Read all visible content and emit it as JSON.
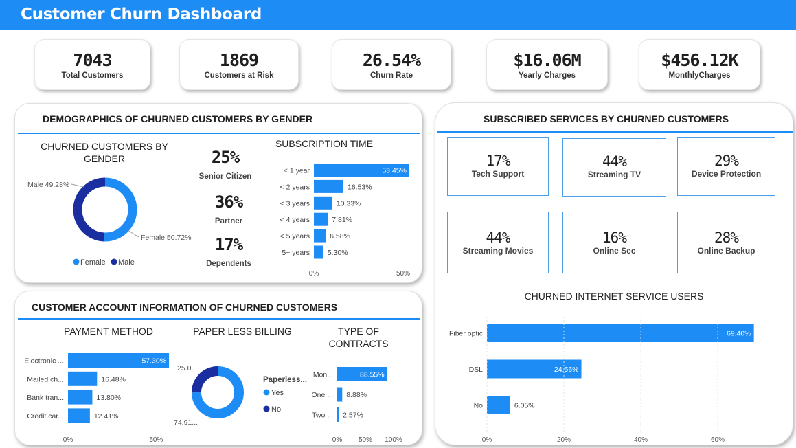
{
  "header": {
    "title": "Customer Churn Dashboard"
  },
  "kpis": [
    {
      "value": "7043",
      "label": "Total Customers"
    },
    {
      "value": "1869",
      "label": "Customers at Risk"
    },
    {
      "value": "26.54%",
      "label": "Churn Rate"
    },
    {
      "value": "$16.06M",
      "label": "Yearly Charges"
    },
    {
      "value": "$456.12K",
      "label": "MonthlyCharges"
    }
  ],
  "demographics": {
    "title": "DEMOGRAPHICS OF CHURNED CUSTOMERS BY GENDER",
    "gender_title": "CHURNED CUSTOMERS BY GENDER",
    "stats": [
      {
        "value": "25%",
        "label": "Senior Citizen"
      },
      {
        "value": "36%",
        "label": "Partner"
      },
      {
        "value": "17%",
        "label": "Dependents"
      }
    ],
    "subscription_title": "SUBSCRIPTION TIME"
  },
  "account": {
    "title": "CUSTOMER ACCOUNT INFORMATION OF CHURNED CUSTOMERS",
    "payment_title": "PAYMENT METHOD",
    "paperless_title": "PAPER LESS BILLING",
    "contracts_title": "TYPE OF CONTRACTS"
  },
  "services": {
    "title": "SUBSCRIBED SERVICES BY CHURNED CUSTOMERS",
    "cards": [
      {
        "value": "17%",
        "label": "Tech Support"
      },
      {
        "value": "44%",
        "label": "Streaming TV"
      },
      {
        "value": "29%",
        "label": "Device Protection"
      },
      {
        "value": "44%",
        "label": "Streaming Movies"
      },
      {
        "value": "16%",
        "label": "Online Sec"
      },
      {
        "value": "28%",
        "label": "Online Backup"
      }
    ],
    "internet_title": "CHURNED INTERNET SERVICE USERS"
  },
  "colors": {
    "accent": "#1e8cf5",
    "dark": "#1a2ea0"
  },
  "chart_data": [
    {
      "type": "pie",
      "subtype": "donut",
      "categories": [
        "Female",
        "Male"
      ],
      "values": [
        50.72,
        49.28
      ],
      "labels": [
        "Female 50.72%",
        "Male 49.28%"
      ],
      "legend": [
        "Female",
        "Male"
      ],
      "colors": [
        "#1e8cf5",
        "#1a2ea0"
      ]
    },
    {
      "type": "bar",
      "orientation": "horizontal",
      "categories": [
        "< 1 year",
        "< 2 years",
        "< 3 years",
        "< 4 years",
        "< 5 years",
        "5+ years"
      ],
      "values": [
        53.45,
        16.53,
        10.33,
        7.81,
        6.58,
        5.3
      ],
      "labels": [
        "53.45%",
        "16.53%",
        "10.33%",
        "7.81%",
        "6.58%",
        "5.30%"
      ],
      "xticks": [
        "0%",
        "50%"
      ],
      "xlim": [
        0,
        60
      ]
    },
    {
      "type": "bar",
      "orientation": "horizontal",
      "categories": [
        "Electronic ...",
        "Mailed ch...",
        "Bank tran...",
        "Credit car..."
      ],
      "values": [
        57.3,
        16.48,
        13.8,
        12.41
      ],
      "labels": [
        "57.30%",
        "16.48%",
        "13.80%",
        "12.41%"
      ],
      "xticks": [
        "0%",
        "50%"
      ],
      "xlim": [
        0,
        60
      ]
    },
    {
      "type": "pie",
      "subtype": "donut",
      "categories": [
        "Yes",
        "No"
      ],
      "values": [
        74.91,
        25.09
      ],
      "labels": [
        "74.91...",
        "25.0..."
      ],
      "legend_title": "Paperless...",
      "legend": [
        "Yes",
        "No"
      ],
      "colors": [
        "#1e8cf5",
        "#1a2ea0"
      ]
    },
    {
      "type": "bar",
      "orientation": "horizontal",
      "categories": [
        "Mon...",
        "One ...",
        "Two ..."
      ],
      "values": [
        88.55,
        8.88,
        2.57
      ],
      "labels": [
        "88.55%",
        "8.88%",
        "2.57%"
      ],
      "xticks": [
        "0%",
        "50%",
        "100%"
      ],
      "xlim": [
        0,
        100
      ]
    },
    {
      "type": "bar",
      "orientation": "horizontal",
      "categories": [
        "Fiber optic",
        "DSL",
        "No"
      ],
      "values": [
        69.4,
        24.56,
        6.05
      ],
      "labels": [
        "69.40%",
        "24.56%",
        "6.05%"
      ],
      "xticks": [
        "0%",
        "20%",
        "40%",
        "60%"
      ],
      "xlim": [
        0,
        80
      ]
    }
  ]
}
